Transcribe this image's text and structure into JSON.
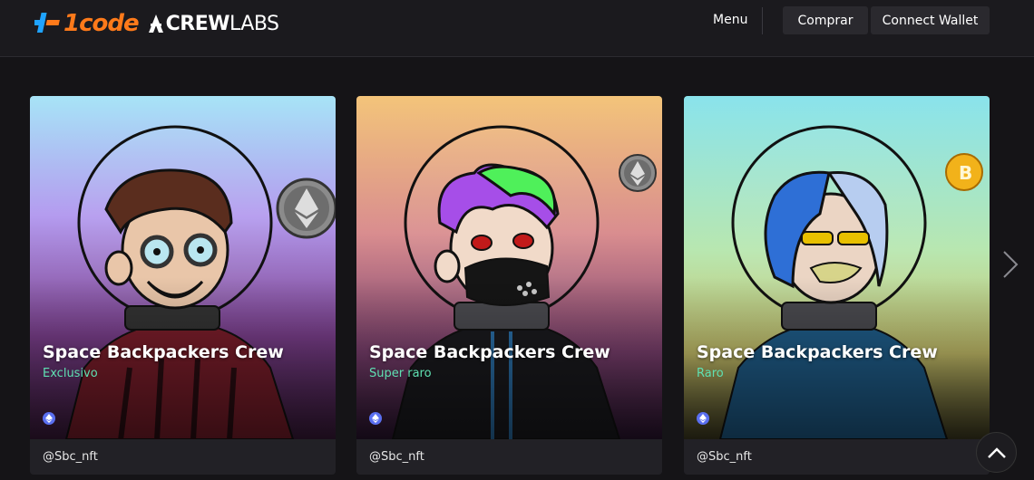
{
  "brand": {
    "logo_1code": "1code",
    "logo_crew_bold": "CREW",
    "logo_crew_light": "LABS"
  },
  "nav": {
    "menu_label": "Menu",
    "buy_label": "Comprar",
    "wallet_label": "Connect Wallet"
  },
  "cards": [
    {
      "title": "Space Backpackers Crew",
      "rarity": "Exclusivo",
      "handle": "@Sbc_nft",
      "coin": "ethereum-coin-icon"
    },
    {
      "title": "Space Backpackers Crew",
      "rarity": "Super raro",
      "handle": "@Sbc_nft",
      "coin": "ethereum-coin-icon"
    },
    {
      "title": "Space Backpackers Crew",
      "rarity": "Raro",
      "handle": "@Sbc_nft",
      "coin": "bitcoin-coin-icon"
    }
  ],
  "colors": {
    "accent_rarity": "#5fe0b2",
    "logo_orange": "#ff7a1a",
    "logo_blue": "#1fa3ff",
    "background": "#151417"
  },
  "icons": {
    "next": "chevron-right-icon",
    "scroll_top": "chevron-up-icon",
    "chain": "ethereum-small-icon"
  }
}
